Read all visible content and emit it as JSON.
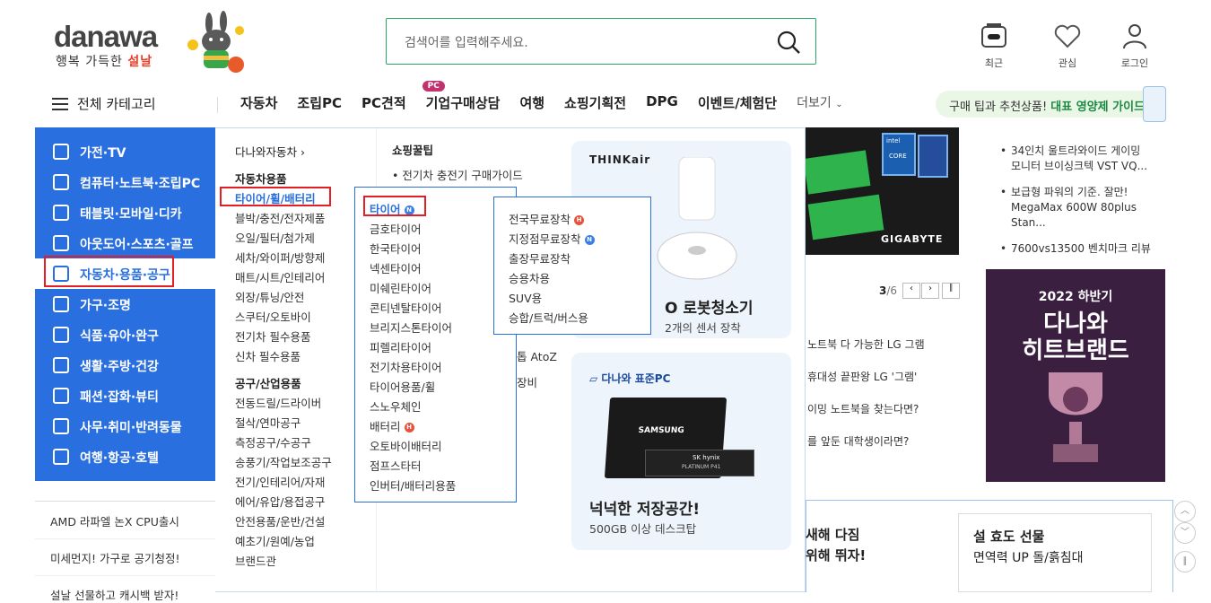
{
  "header": {
    "logo": "danawa",
    "slogan": "행복 가득한",
    "slogan_red": "설날",
    "search_placeholder": "검색어를 입력해주세요.",
    "util": [
      {
        "label": "최근"
      },
      {
        "label": "관심"
      },
      {
        "label": "로그인"
      }
    ]
  },
  "nav": {
    "menu_label": "전체 카테고리",
    "items": [
      "자동차",
      "조립PC",
      "PC견적",
      "기업구매상담",
      "여행",
      "쇼핑기획전",
      "DPG",
      "이벤트/체험단"
    ],
    "pc_badge": "PC",
    "more": "더보기",
    "promo_text": "구매 팁과 추천상품!",
    "promo_bold": "대표 영양제 가이드"
  },
  "categories": [
    "가전·TV",
    "컴퓨터·노트북·조립PC",
    "태블릿·모바일·디카",
    "아웃도어·스포츠·골프",
    "자동차·용품·공구",
    "가구·조명",
    "식품·유아·완구",
    "생활·주방·건강",
    "패션·잡화·뷰티",
    "사무·취미·반려동물",
    "여행·항공·호텔"
  ],
  "col1": {
    "link_top": "다나와자동차 ›",
    "head1": "자동차용품",
    "links1": [
      "타이어/휠/배터리",
      "블박/충전/전자제품",
      "오일/필터/첨가제",
      "세차/와이퍼/방향제",
      "매트/시트/인테리어",
      "외장/튜닝/안전",
      "스쿠터/오토바이",
      "전기차 필수용품",
      "신차 필수용품"
    ],
    "head2": "공구/산업용품",
    "links2": [
      "전동드릴/드라이버",
      "절삭/연마공구",
      "측정공구/수공구",
      "송풍기/작업보조공구",
      "전기/인테리어/자재",
      "에어/유압/용접공구",
      "안전용품/운반/건설",
      "예초기/원예/농업",
      "브랜드관"
    ]
  },
  "col2": {
    "head": "쇼핑꿀팁",
    "links": [
      "전기차 충전기 구매가이드",
      "톱 AtoZ",
      "장비"
    ]
  },
  "sub1": [
    "타이어",
    "금호타이어",
    "한국타이어",
    "넥센타이어",
    "미쉐린타이어",
    "콘티넨탈타이어",
    "브리지스톤타이어",
    "피렐리타이어",
    "전기차용타이어",
    "타이어용품/휠",
    "스노우체인",
    "배터리",
    "오토바이배터리",
    "점프스타터",
    "인버터/배터리용품"
  ],
  "sub2": [
    "전국무료장착",
    "지정점무료장착",
    "출장무료장착",
    "승용차용",
    "SUV용",
    "승합/트럭/버스용"
  ],
  "badges": {
    "n": "N",
    "h": "H"
  },
  "cards": [
    {
      "brand": "THINKair",
      "title": "O 로봇청소기",
      "sub": "2개의 센서 장착"
    },
    {
      "brand": "다나와 표준PC",
      "title": "넉넉한 저장공간!",
      "sub": "500GB 이상 데스크탑",
      "ssd1": "SAMSUNG",
      "ssd2": "SK hynix",
      "ssd3": "PLATINUM P41"
    }
  ],
  "right": {
    "news": [
      "34인치 울트라와이드 게이밍 모니터 브이싱크텍 VST VQ...",
      "보급형 파워의 기준. 잘만! MegaMax 600W 80plus Stan...",
      "7600vs13500 벤치마크 리뷰"
    ],
    "pager": "3",
    "pager_total": "/6",
    "strip": [
      "노트북 다 가능한 LG 그램",
      "휴대성 끝판왕 LG '그램'",
      "이밍 노트북을 찾는다면?",
      "를 앞둔 대학생이라면?"
    ],
    "gigabyte": "GIGABYTE",
    "intel": "intel",
    "core": "CORE",
    "hit_year": "2022 하반기",
    "hit_title1": "다나와",
    "hit_title2": "히트브랜드",
    "card3": "새해 다짐",
    "card3b": "위해 뛰자!",
    "card4": "설 효도 선물",
    "card4b": "면역력 UP 돌/흙침대"
  },
  "bottom": [
    "AMD 라파엘 논X CPU출시",
    "미세먼지! 가구로 공기청정!",
    "설날 선물하고 캐시백 받자!"
  ],
  "colors": {
    "brand_blue": "#2a6fe0",
    "brand_green": "#2aa663",
    "highlight": "#e31e24"
  }
}
